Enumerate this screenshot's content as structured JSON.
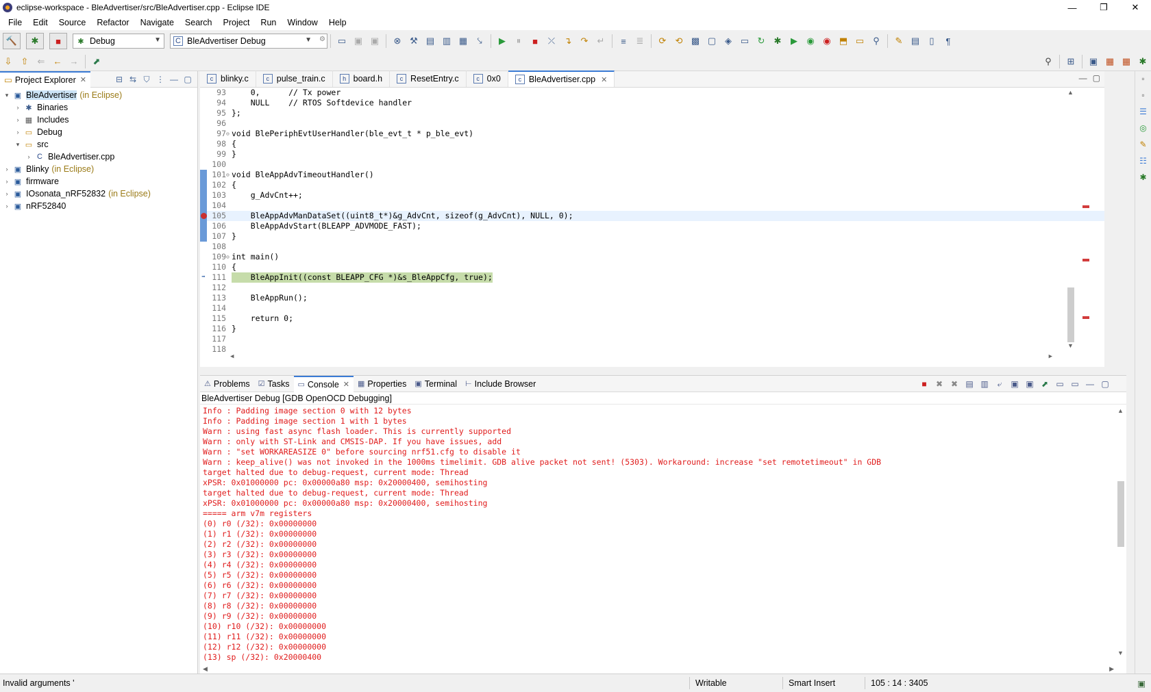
{
  "window": {
    "title": "eclipse-workspace - BleAdvertiser/src/BleAdvertiser.cpp - Eclipse IDE",
    "minimize": "—",
    "maximize": "❐",
    "close": "✕"
  },
  "menu": [
    "File",
    "Edit",
    "Source",
    "Refactor",
    "Navigate",
    "Search",
    "Project",
    "Run",
    "Window",
    "Help"
  ],
  "toolbar": {
    "mode_combo": "Debug",
    "launch_combo": "BleAdvertiser Debug"
  },
  "explorer": {
    "tab_label": "Project Explorer",
    "tree": [
      {
        "label": "BleAdvertiser",
        "suffix": "(in Eclipse)",
        "level": 0,
        "expanded": true,
        "icon": "project-icon",
        "selected": true
      },
      {
        "label": "Binaries",
        "suffix": "",
        "level": 1,
        "expanded": false,
        "icon": "binaries-icon"
      },
      {
        "label": "Includes",
        "suffix": "",
        "level": 1,
        "expanded": false,
        "icon": "includes-icon"
      },
      {
        "label": "Debug",
        "suffix": "",
        "level": 1,
        "expanded": false,
        "icon": "folder-icon"
      },
      {
        "label": "src",
        "suffix": "",
        "level": 1,
        "expanded": true,
        "icon": "source-folder-icon"
      },
      {
        "label": "BleAdvertiser.cpp",
        "suffix": "",
        "level": 2,
        "expanded": false,
        "icon": "cpp-file-icon"
      },
      {
        "label": "Blinky",
        "suffix": "(in Eclipse)",
        "level": 0,
        "expanded": false,
        "icon": "project-icon"
      },
      {
        "label": "firmware",
        "suffix": "",
        "level": 0,
        "expanded": false,
        "icon": "project-icon"
      },
      {
        "label": "IOsonata_nRF52832",
        "suffix": "(in Eclipse)",
        "level": 0,
        "expanded": false,
        "icon": "project-icon"
      },
      {
        "label": "nRF52840",
        "suffix": "",
        "level": 0,
        "expanded": false,
        "icon": "project-icon"
      }
    ]
  },
  "editor": {
    "tabs": [
      {
        "label": "blinky.c",
        "active": false
      },
      {
        "label": "pulse_train.c",
        "active": false
      },
      {
        "label": "board.h",
        "active": false
      },
      {
        "label": "ResetEntry.c",
        "active": false
      },
      {
        "label": "0x0",
        "active": false
      },
      {
        "label": "BleAdvertiser.cpp",
        "active": true
      }
    ],
    "lines": [
      {
        "n": "93",
        "t": "    0,      // Tx power"
      },
      {
        "n": "94",
        "t": "    NULL    // RTOS Softdevice handler"
      },
      {
        "n": "95",
        "t": "};"
      },
      {
        "n": "96",
        "t": ""
      },
      {
        "n": "97",
        "t": "void BlePeriphEvtUserHandler(ble_evt_t * p_ble_evt)",
        "fold": true
      },
      {
        "n": "98",
        "t": "{"
      },
      {
        "n": "99",
        "t": "}"
      },
      {
        "n": "100",
        "t": ""
      },
      {
        "n": "101",
        "t": "void BleAppAdvTimeoutHandler()",
        "fold": true,
        "changed": true
      },
      {
        "n": "102",
        "t": "{",
        "changed": true
      },
      {
        "n": "103",
        "t": "    g_AdvCnt++;",
        "changed": true
      },
      {
        "n": "104",
        "t": "",
        "changed": true
      },
      {
        "n": "105",
        "t": "    BleAppAdvManDataSet((uint8_t*)&g_AdvCnt, sizeof(g_AdvCnt), NULL, 0);",
        "changed": true,
        "current": true,
        "breakpoint": true
      },
      {
        "n": "106",
        "t": "    BleAppAdvStart(BLEAPP_ADVMODE_FAST);",
        "changed": true
      },
      {
        "n": "107",
        "t": "}",
        "changed": true
      },
      {
        "n": "108",
        "t": ""
      },
      {
        "n": "109",
        "t": "int main()",
        "fold": true
      },
      {
        "n": "110",
        "t": "{"
      },
      {
        "n": "111",
        "t": "    BleAppInit((const BLEAPP_CFG *)&s_BleAppCfg, true);",
        "debug": true
      },
      {
        "n": "112",
        "t": ""
      },
      {
        "n": "113",
        "t": "    BleAppRun();"
      },
      {
        "n": "114",
        "t": ""
      },
      {
        "n": "115",
        "t": "    return 0;"
      },
      {
        "n": "116",
        "t": "}"
      },
      {
        "n": "117",
        "t": ""
      },
      {
        "n": "118",
        "t": ""
      }
    ]
  },
  "console": {
    "tabs": [
      {
        "label": "Problems",
        "active": false
      },
      {
        "label": "Tasks",
        "active": false
      },
      {
        "label": "Console",
        "active": true
      },
      {
        "label": "Properties",
        "active": false
      },
      {
        "label": "Terminal",
        "active": false
      },
      {
        "label": "Include Browser",
        "active": false
      }
    ],
    "header": "BleAdvertiser Debug [GDB OpenOCD Debugging]",
    "lines": [
      "Info : Padding image section 0 with 12 bytes",
      "Info : Padding image section 1 with 1 bytes",
      "Warn : using fast async flash loader. This is currently supported",
      "Warn : only with ST-Link and CMSIS-DAP. If you have issues, add",
      "Warn : \"set WORKAREASIZE 0\" before sourcing nrf51.cfg to disable it",
      "Warn : keep_alive() was not invoked in the 1000ms timelimit. GDB alive packet not sent! (5303). Workaround: increase \"set remotetimeout\" in GDB",
      "target halted due to debug-request, current mode: Thread",
      "xPSR: 0x01000000 pc: 0x00000a80 msp: 0x20000400, semihosting",
      "target halted due to debug-request, current mode: Thread",
      "xPSR: 0x01000000 pc: 0x00000a80 msp: 0x20000400, semihosting",
      "===== arm v7m registers",
      "(0) r0 (/32): 0x00000000",
      "(1) r1 (/32): 0x00000000",
      "(2) r2 (/32): 0x00000000",
      "(3) r3 (/32): 0x00000000",
      "(4) r4 (/32): 0x00000000",
      "(5) r5 (/32): 0x00000000",
      "(6) r6 (/32): 0x00000000",
      "(7) r7 (/32): 0x00000000",
      "(8) r8 (/32): 0x00000000",
      "(9) r9 (/32): 0x00000000",
      "(10) r10 (/32): 0x00000000",
      "(11) r11 (/32): 0x00000000",
      "(12) r12 (/32): 0x00000000",
      "(13) sp (/32): 0x20000400"
    ]
  },
  "status": {
    "message": "Invalid arguments '",
    "writable": "Writable",
    "insert_mode": "Smart Insert",
    "position": "105 : 14 : 3405"
  },
  "colors": {
    "console_text": "#e01b1b",
    "debug_line": "#c6dcaa",
    "current_line": "#e8f2fe",
    "change_bar": "#6a9ad8"
  }
}
